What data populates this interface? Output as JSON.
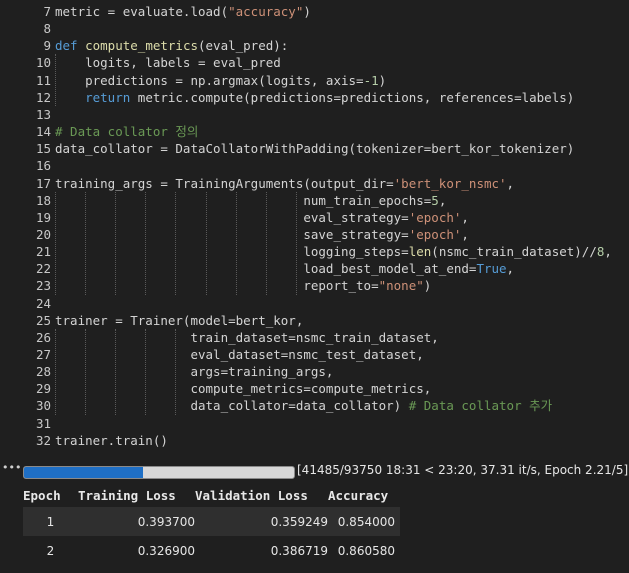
{
  "code_lines": [
    {
      "n": "7",
      "tokens": [
        [
          "metric = evaluate.load(",
          ""
        ],
        [
          "\"accuracy\"",
          "str"
        ],
        [
          ")",
          ""
        ]
      ]
    },
    {
      "n": "8",
      "tokens": []
    },
    {
      "n": "9",
      "tokens": [
        [
          "def ",
          "kw"
        ],
        [
          "compute_metrics",
          "fn"
        ],
        [
          "(eval_pred):",
          ""
        ]
      ]
    },
    {
      "n": "10",
      "tokens": [
        [
          "    logits, labels = eval_pred",
          ""
        ]
      ]
    },
    {
      "n": "11",
      "tokens": [
        [
          "    predictions = np.argmax(logits, axis=",
          ""
        ],
        [
          "-1",
          "num"
        ],
        [
          ")",
          ""
        ]
      ]
    },
    {
      "n": "12",
      "tokens": [
        [
          "    ",
          ""
        ],
        [
          "return ",
          "kw"
        ],
        [
          "metric.compute(predictions=predictions, references=labels)",
          ""
        ]
      ]
    },
    {
      "n": "13",
      "tokens": []
    },
    {
      "n": "14",
      "tokens": [
        [
          "# Data collator 정의",
          "cm"
        ]
      ]
    },
    {
      "n": "15",
      "tokens": [
        [
          "data_collator = DataCollatorWithPadding(tokenizer=bert_kor_tokenizer)",
          ""
        ]
      ]
    },
    {
      "n": "16",
      "tokens": []
    },
    {
      "n": "17",
      "tokens": [
        [
          "training_args = TrainingArguments(output_dir=",
          ""
        ],
        [
          "'bert_kor_nsmc'",
          "str"
        ],
        [
          ",",
          ""
        ]
      ]
    },
    {
      "n": "18",
      "tokens": [
        [
          "                                 num_train_epochs=",
          ""
        ],
        [
          "5",
          "num"
        ],
        [
          ",",
          ""
        ]
      ]
    },
    {
      "n": "19",
      "tokens": [
        [
          "                                 eval_strategy=",
          ""
        ],
        [
          "'epoch'",
          "str"
        ],
        [
          ",",
          ""
        ]
      ]
    },
    {
      "n": "20",
      "tokens": [
        [
          "                                 save_strategy=",
          ""
        ],
        [
          "'epoch'",
          "str"
        ],
        [
          ",",
          ""
        ]
      ]
    },
    {
      "n": "21",
      "tokens": [
        [
          "                                 logging_steps=",
          ""
        ],
        [
          "len",
          "bi"
        ],
        [
          "(nsmc_train_dataset)//",
          ""
        ],
        [
          "8",
          "num"
        ],
        [
          ",",
          ""
        ]
      ]
    },
    {
      "n": "22",
      "tokens": [
        [
          "                                 load_best_model_at_end=",
          ""
        ],
        [
          "True",
          "kw"
        ],
        [
          ",",
          ""
        ]
      ]
    },
    {
      "n": "23",
      "tokens": [
        [
          "                                 report_to=",
          ""
        ],
        [
          "\"none\"",
          "str"
        ],
        [
          ")",
          ""
        ]
      ]
    },
    {
      "n": "24",
      "tokens": []
    },
    {
      "n": "25",
      "tokens": [
        [
          "trainer = Trainer(model=bert_kor,",
          ""
        ]
      ]
    },
    {
      "n": "26",
      "tokens": [
        [
          "                  train_dataset=nsmc_train_dataset,",
          ""
        ]
      ]
    },
    {
      "n": "27",
      "tokens": [
        [
          "                  eval_dataset=nsmc_test_dataset,",
          ""
        ]
      ]
    },
    {
      "n": "28",
      "tokens": [
        [
          "                  args=training_args,",
          ""
        ]
      ]
    },
    {
      "n": "29",
      "tokens": [
        [
          "                  compute_metrics=compute_metrics,",
          ""
        ]
      ]
    },
    {
      "n": "30",
      "tokens": [
        [
          "                  data_collator=data_collator) ",
          ""
        ],
        [
          "# Data collator 추가",
          "cm"
        ]
      ]
    },
    {
      "n": "31",
      "tokens": []
    },
    {
      "n": "32",
      "tokens": [
        [
          "trainer.train()",
          ""
        ]
      ]
    }
  ],
  "output": {
    "ellipsis": "•••",
    "progress_fraction": 0.4425,
    "progress_text": "[41485/93750 18:31 < 23:20, 37.31 it/s, Epoch 2.21/5]",
    "table": {
      "headers": [
        "Epoch",
        "Training Loss",
        "Validation Loss",
        "Accuracy"
      ],
      "rows": [
        [
          "1",
          "0.393700",
          "0.359249",
          "0.854000"
        ],
        [
          "2",
          "0.326900",
          "0.386719",
          "0.860580"
        ]
      ]
    }
  }
}
